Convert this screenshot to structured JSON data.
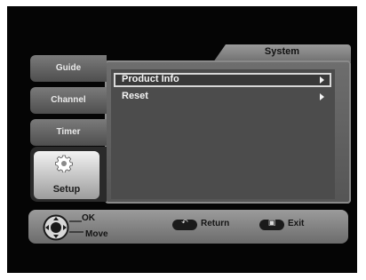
{
  "panel": {
    "title": "System"
  },
  "menu": [
    {
      "label": "Product Info",
      "selected": true
    },
    {
      "label": "Reset",
      "selected": false
    }
  ],
  "side_tabs": [
    {
      "label": "Guide"
    },
    {
      "label": "Channel"
    },
    {
      "label": "Timer"
    },
    {
      "label": "Setup",
      "active": true
    }
  ],
  "bottom_bar": {
    "ok_label": "OK",
    "move_label": "Move",
    "return_label": "Return",
    "exit_label": "Exit",
    "return_icon": "return-arrow-icon",
    "exit_icon": "exit-key-icon"
  }
}
